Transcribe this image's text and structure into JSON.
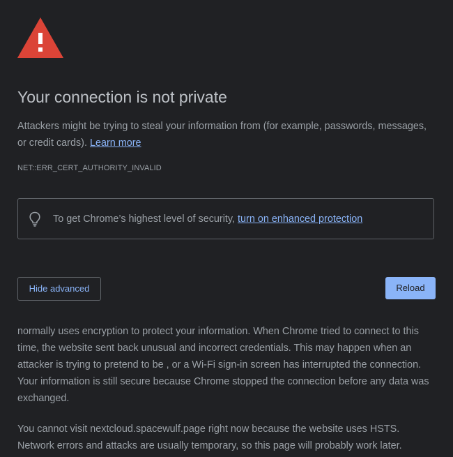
{
  "title": "Your connection is not private",
  "intro": {
    "text": "Attackers might be trying to steal your information from (for example, passwords, messages, or credit cards).",
    "learn_more": "Learn more"
  },
  "error_code": "NET::ERR_CERT_AUTHORITY_INVALID",
  "promo": {
    "icon": "lightbulb-icon",
    "text": "To get Chrome’s highest level of security,",
    "link": "turn on enhanced protection"
  },
  "buttons": {
    "hide_advanced": "Hide advanced",
    "reload": "Reload"
  },
  "details": "normally uses encryption to protect your information. When Chrome tried to connect to this time, the website sent back unusual and incorrect credentials. This may happen when an attacker is trying to pretend to be , or a Wi-Fi sign-in screen has interrupted the connection. Your information is still secure because Chrome stopped the connection before any data was exchanged.",
  "hsts": "You cannot visit nextcloud.spacewulf.page right now because the website uses HSTS. Network errors and attacks are usually temporary, so this page will probably work later.",
  "colors": {
    "background": "#202124",
    "warning_red": "#db4437",
    "link_blue": "#8ab4f8",
    "text": "#9aa0a6"
  }
}
